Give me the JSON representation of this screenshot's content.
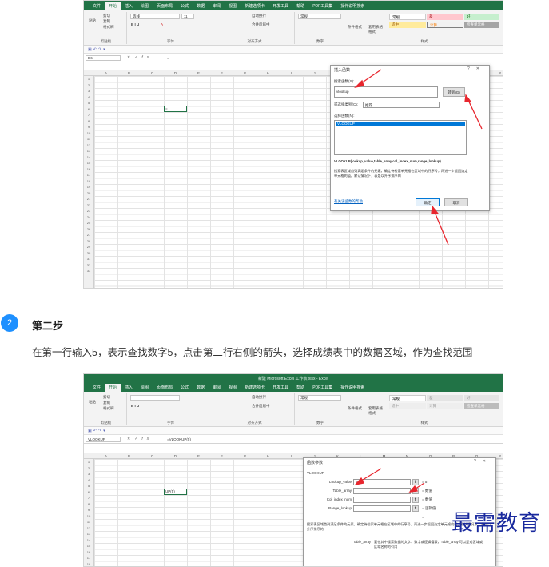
{
  "screenshot1": {
    "ribbon_tabs": [
      "文件",
      "开始",
      "插入",
      "绘图",
      "页面布局",
      "公式",
      "数据",
      "审阅",
      "视图",
      "新建选项卡",
      "开发工具",
      "帮助",
      "PDF工具集",
      "操作说明搜索"
    ],
    "active_tab": "开始",
    "clipboard": {
      "paste": "粘贴",
      "cut": "剪切",
      "copy": "复制",
      "format_painter": "格式刷",
      "label": "剪贴板"
    },
    "font": {
      "name": "等线",
      "size": "11",
      "label": "字体"
    },
    "alignment": {
      "wrap": "自动换行",
      "merge": "合并后居中",
      "label": "对齐方式"
    },
    "number": {
      "format": "常规",
      "label": "数字"
    },
    "styles": {
      "cond_format": "条件格式",
      "table_format": "套用表格格式",
      "normal": "常规",
      "bad": "差",
      "good": "好",
      "neutral": "适中",
      "calc": "计算",
      "check": "检查单元格",
      "label": "样式"
    },
    "name_box": "D6",
    "formula": "=",
    "columns": [
      "A",
      "B",
      "C",
      "D",
      "E",
      "F",
      "G",
      "H",
      "I",
      "J",
      "K",
      "L",
      "M",
      "N",
      "O",
      "P",
      "Q",
      "R"
    ],
    "rows": [
      "1",
      "2",
      "3",
      "4",
      "5",
      "6",
      "7",
      "8",
      "9",
      "10",
      "11",
      "12",
      "13",
      "14",
      "15",
      "16",
      "17",
      "18",
      "19",
      "20",
      "21",
      "22",
      "23",
      "24",
      "25",
      "26",
      "27",
      "28",
      "29",
      "30",
      "31",
      "32",
      "33"
    ],
    "active_cell_text": "=",
    "dialog": {
      "title": "插入函数",
      "help": "?",
      "close": "✕",
      "search_label": "搜索函数(S):",
      "search_value": "vlookup",
      "go_button": "转到(G)",
      "category_label": "或选择类别(C):",
      "category_value": "推荐",
      "select_label": "选择函数(N):",
      "functions": [
        "VLOOKUP"
      ],
      "signature": "VLOOKUP(lookup_value,table_array,col_index_num,range_lookup)",
      "description": "搜索表区域首列满足条件的元素，确定待检索单元格在区域中的行序号，再进一步返回选定单元格的值。默认情况下，表是以升序排序的",
      "help_link": "有关该函数的帮助",
      "ok": "确定",
      "cancel": "取消"
    }
  },
  "step": {
    "number": "2",
    "title": "第二步",
    "text": "在第一行输入5，表示查找数字5，点击第二行右侧的箭头，选择成绩表中的数据区域，作为查找范围"
  },
  "screenshot2": {
    "window_title": "新建 Microsoft Excel 工作表.xlsx - Excel",
    "name_box": "VLOOKUP",
    "formula": "=VLOOKUP(5)",
    "active_cell_text": "UP(5)",
    "dialog": {
      "title": "函数参数",
      "help": "?",
      "close": "✕",
      "function_name": "VLOOKUP",
      "args": [
        {
          "label": "Lookup_value",
          "value": "5",
          "result": "= 5"
        },
        {
          "label": "Table_array",
          "value": "",
          "result": "= 数值"
        },
        {
          "label": "Col_index_num",
          "value": "",
          "result": "= 数值"
        },
        {
          "label": "Range_lookup",
          "value": "",
          "result": "= 逻辑值"
        }
      ],
      "equals": "=",
      "description": "搜索表区域首列满足条件的元素，确定待检索单元格在区域中的行序号，再进一步返回选定单元格的值。默认情况下，表是以升序排序的",
      "arg_desc_label": "Table_array",
      "arg_desc": "要在其中搜索数据的文字、数字或逻辑值表，Table_array 可以是对区域或区域名称的引用"
    }
  },
  "watermark": "最需教育",
  "colors": {
    "excel_green": "#217346",
    "badge_blue": "#1e90ff",
    "arrow_red": "#e8262e",
    "watermark": "#1a2a9e"
  }
}
